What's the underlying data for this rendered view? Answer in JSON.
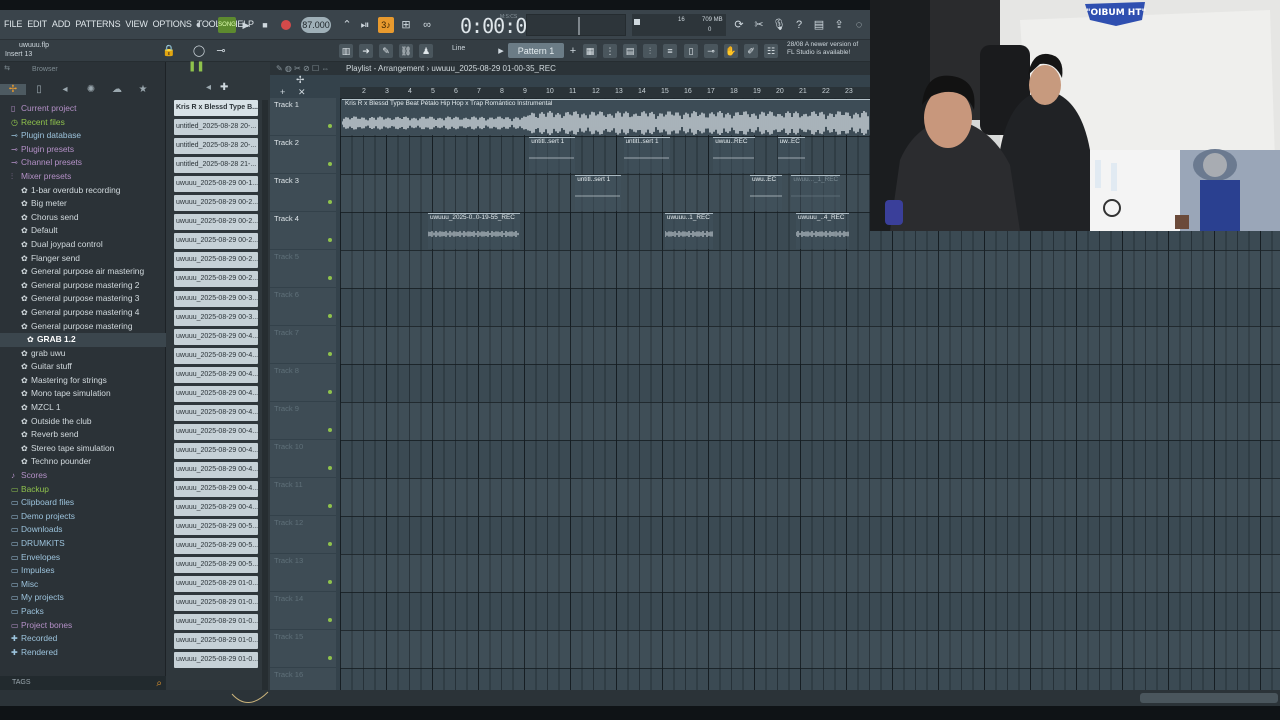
{
  "menu": [
    "FILE",
    "EDIT",
    "ADD",
    "PATTERNS",
    "VIEW",
    "OPTIONS",
    "TOOLS",
    "HELP"
  ],
  "transport": {
    "mode": "SONG",
    "tempo": "87.000",
    "time": "0:00:00",
    "time_unit": "M:S:CS",
    "cpu_poly": "16",
    "cpu_mem": "709 MB",
    "cpu_zero": "0"
  },
  "hint": {
    "file": "uwuuu.flp",
    "insert": "Insert 13"
  },
  "snap": "Line",
  "pattern": "Pattern 1",
  "news": {
    "line1": "28/08  A newer version of",
    "line2": "FL Studio is available!"
  },
  "browser": {
    "title": "Browser",
    "tags_label": "TAGS",
    "items": [
      {
        "label": "Current project",
        "kind": "folder",
        "icon": "document-icon"
      },
      {
        "label": "Recent files",
        "kind": "green",
        "icon": "clock-icon"
      },
      {
        "label": "Plugin database",
        "kind": "blue",
        "icon": "plug-icon"
      },
      {
        "label": "Plugin presets",
        "kind": "folder",
        "icon": "plug-icon"
      },
      {
        "label": "Channel presets",
        "kind": "folder",
        "icon": "plug-icon"
      },
      {
        "label": "Mixer presets",
        "kind": "folder",
        "icon": "mixer-icon"
      },
      {
        "label": "1-bar overdub recording",
        "kind": "sub",
        "icon": "gear-icon"
      },
      {
        "label": "Big meter",
        "kind": "sub",
        "icon": "gear-icon"
      },
      {
        "label": "Chorus send",
        "kind": "sub",
        "icon": "gear-icon"
      },
      {
        "label": "Default",
        "kind": "sub",
        "icon": "gear-icon"
      },
      {
        "label": "Dual joypad control",
        "kind": "sub",
        "icon": "gear-icon"
      },
      {
        "label": "Flanger send",
        "kind": "sub",
        "icon": "gear-icon"
      },
      {
        "label": "General purpose air mastering",
        "kind": "sub",
        "icon": "gear-icon"
      },
      {
        "label": "General purpose mastering 2",
        "kind": "sub",
        "icon": "gear-icon"
      },
      {
        "label": "General purpose mastering 3",
        "kind": "sub",
        "icon": "gear-icon"
      },
      {
        "label": "General purpose mastering 4",
        "kind": "sub",
        "icon": "gear-icon"
      },
      {
        "label": "General purpose mastering",
        "kind": "sub",
        "icon": "gear-icon"
      },
      {
        "label": "GRAB 1.2",
        "kind": "sel",
        "icon": "gear-icon"
      },
      {
        "label": "grab uwu",
        "kind": "sub",
        "icon": "gear-icon"
      },
      {
        "label": "Guitar stuff",
        "kind": "sub",
        "icon": "gear-icon"
      },
      {
        "label": "Mastering for strings",
        "kind": "sub",
        "icon": "gear-icon"
      },
      {
        "label": "Mono tape simulation",
        "kind": "sub",
        "icon": "gear-icon"
      },
      {
        "label": "MZCL 1",
        "kind": "sub",
        "icon": "gear-icon"
      },
      {
        "label": "Outside the club",
        "kind": "sub",
        "icon": "gear-icon"
      },
      {
        "label": "Reverb send",
        "kind": "sub",
        "icon": "gear-icon"
      },
      {
        "label": "Stereo tape simulation",
        "kind": "sub",
        "icon": "gear-icon"
      },
      {
        "label": "Techno pounder",
        "kind": "sub",
        "icon": "gear-icon"
      },
      {
        "label": "Scores",
        "kind": "folder",
        "icon": "note-icon"
      },
      {
        "label": "Backup",
        "kind": "green",
        "icon": "folder-icon"
      },
      {
        "label": "Clipboard files",
        "kind": "blue",
        "icon": "folder-icon"
      },
      {
        "label": "Demo projects",
        "kind": "blue",
        "icon": "folder-icon"
      },
      {
        "label": "Downloads",
        "kind": "blue",
        "icon": "folder-icon"
      },
      {
        "label": "DRUMKITS",
        "kind": "blue",
        "icon": "folder-icon"
      },
      {
        "label": "Envelopes",
        "kind": "blue",
        "icon": "folder-icon"
      },
      {
        "label": "Impulses",
        "kind": "blue",
        "icon": "folder-icon"
      },
      {
        "label": "Misc",
        "kind": "blue",
        "icon": "folder-icon"
      },
      {
        "label": "My projects",
        "kind": "blue",
        "icon": "folder-icon"
      },
      {
        "label": "Packs",
        "kind": "blue",
        "icon": "folder-icon"
      },
      {
        "label": "Project bones",
        "kind": "folder",
        "icon": "folder-icon"
      },
      {
        "label": "Recorded",
        "kind": "blue",
        "icon": "plus-icon"
      },
      {
        "label": "Rendered",
        "kind": "blue",
        "icon": "plus-icon"
      }
    ]
  },
  "picker": [
    "Kris R x Blessd Type B...",
    "untitled_2025-08-28 20-...",
    "untitled_2025-08-28 20-...",
    "untitled_2025-08-28 21-...",
    "uwuuu_2025-08-29 00-1...",
    "uwuuu_2025-08-29 00-2...",
    "uwuuu_2025-08-29 00-2...",
    "uwuuu_2025-08-29 00-2...",
    "uwuuu_2025-08-29 00-2...",
    "uwuuu_2025-08-29 00-2...",
    "uwuuu_2025-08-29 00-3...",
    "uwuuu_2025-08-29 00-3...",
    "uwuuu_2025-08-29 00-4...",
    "uwuuu_2025-08-29 00-4...",
    "uwuuu_2025-08-29 00-4...",
    "uwuuu_2025-08-29 00-4...",
    "uwuuu_2025-08-29 00-4...",
    "uwuuu_2025-08-29 00-4...",
    "uwuuu_2025-08-29 00-4...",
    "uwuuu_2025-08-29 00-4...",
    "uwuuu_2025-08-29 00-4...",
    "uwuuu_2025-08-29 00-4...",
    "uwuuu_2025-08-29 00-5...",
    "uwuuu_2025-08-29 00-5...",
    "uwuuu_2025-08-29 00-5...",
    "uwuuu_2025-08-29 01-0...",
    "uwuuu_2025-08-29 01-0...",
    "uwuuu_2025-08-29 01-0...",
    "uwuuu_2025-08-29 01-0...",
    "uwuuu_2025-08-29 01-0..."
  ],
  "playlist": {
    "title": "Playlist - Arrangement › uwuuu_2025-08-29 01-00-35_REC",
    "ruler": [
      "2",
      "3",
      "4",
      "5",
      "6",
      "7",
      "8",
      "9",
      "10",
      "11",
      "12",
      "13",
      "14",
      "15",
      "16",
      "17",
      "18",
      "19",
      "20",
      "21",
      "22",
      "23"
    ],
    "tracks": [
      "Track 1",
      "Track 2",
      "Track 3",
      "Track 4",
      "Track 5",
      "Track 6",
      "Track 7",
      "Track 8",
      "Track 9",
      "Track 10",
      "Track 11",
      "Track 12",
      "Track 13",
      "Track 14",
      "Track 15",
      "Track 16"
    ],
    "audio_clip": "Kris R x Blessd Type Beat  Pétalo  Hip Hop x Trap Romántico Instrumental",
    "clips": [
      {
        "track": 2,
        "start": 9.4,
        "len": 2,
        "label": "untitl..sert 1",
        "faded": false
      },
      {
        "track": 2,
        "start": 13.5,
        "len": 2,
        "label": "untitl..sert 1",
        "faded": false
      },
      {
        "track": 2,
        "start": 17.4,
        "len": 1.8,
        "label": "uwuu..REC",
        "faded": false
      },
      {
        "track": 2,
        "start": 20.2,
        "len": 1.2,
        "label": "uw..EC",
        "faded": false
      },
      {
        "track": 3,
        "start": 11.4,
        "len": 2,
        "label": "untitl..sert 1",
        "faded": false
      },
      {
        "track": 3,
        "start": 19.0,
        "len": 1.4,
        "label": "uwu..EC",
        "faded": false
      },
      {
        "track": 3,
        "start": 20.8,
        "len": 2.1,
        "label": "uwuu..._1_REC",
        "faded": true
      },
      {
        "track": 4,
        "start": 5.0,
        "len": 4.0,
        "label": "uwuuu_2025-0..0-19-55_REC",
        "faded": false
      },
      {
        "track": 4,
        "start": 15.3,
        "len": 2.1,
        "label": "uwuuu..1_REC",
        "faded": false
      },
      {
        "track": 4,
        "start": 21.0,
        "len": 2.3,
        "label": "uwuuu_..4_REC",
        "faded": false
      }
    ]
  },
  "webcam": {
    "sign": "\"OIBUM HT\""
  }
}
